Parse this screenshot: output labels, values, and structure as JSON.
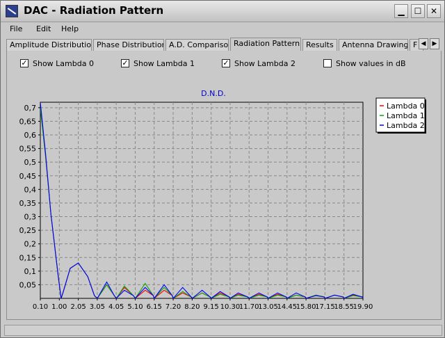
{
  "window": {
    "title": "DAC - Radiation Pattern"
  },
  "menu": [
    "File",
    "Edit",
    "Help"
  ],
  "tabs": [
    "Amplitude Distribution",
    "Phase Distribution",
    "A.D. Comparison",
    "Radiation Pattern",
    "Results",
    "Antenna Drawing",
    "F"
  ],
  "active_tab": "Radiation Pattern",
  "checkboxes": [
    {
      "label": "Show Lambda 0",
      "checked": true
    },
    {
      "label": "Show Lambda 1",
      "checked": true
    },
    {
      "label": "Show Lambda 2",
      "checked": true
    },
    {
      "label": "Show values in dB",
      "checked": false
    }
  ],
  "colors": {
    "lambda0": "#ff0000",
    "lambda1": "#00aa00",
    "lambda2": "#0000ff",
    "chart_title": "#0000cc"
  },
  "chart_data": {
    "type": "line",
    "title": "D.N.D.",
    "xlabel": "",
    "ylabel": "",
    "x_ticks": [
      "0.10",
      "1.00",
      "2.05",
      "3.05",
      "4.05",
      "5.10",
      "6.15",
      "7.20",
      "8.20",
      "9.15",
      "10.30",
      "11.70",
      "13.05",
      "14.45",
      "15.80",
      "17.15",
      "18.55",
      "19.90"
    ],
    "y_ticks": [
      "0,05",
      "0,1",
      "0,15",
      "0,2",
      "0,25",
      "0,3",
      "0,35",
      "0,4",
      "0,45",
      "0,5",
      "0,55",
      "0,6",
      "0,65",
      "0,7"
    ],
    "ylim": [
      0,
      0.72
    ],
    "grid": true,
    "legend_placement": "top-right",
    "series": [
      {
        "name": "Lambda 0",
        "x": [
          0.1,
          0.35,
          0.6,
          0.95,
          1.1,
          1.2,
          1.6,
          2.05,
          2.55,
          2.9,
          3.05,
          3.55,
          3.95,
          4.05,
          4.5,
          5.0,
          5.1,
          5.65,
          6.1,
          6.15,
          6.7,
          7.15,
          7.2,
          7.7,
          8.15,
          8.2,
          8.7,
          9.1,
          9.15,
          9.7,
          10.25,
          10.3,
          10.9,
          11.6,
          11.7,
          12.4,
          13.0,
          13.05,
          13.75,
          14.4,
          14.45,
          15.1,
          15.75,
          15.8,
          16.5,
          17.1,
          17.15,
          17.85,
          18.5,
          18.55,
          19.2,
          19.85,
          19.9
        ],
        "y": [
          0.7,
          0.52,
          0.31,
          0.08,
          0.0,
          0.02,
          0.11,
          0.13,
          0.08,
          0.01,
          0.0,
          0.05,
          0.01,
          0.0,
          0.04,
          0.01,
          0.0,
          0.03,
          0.01,
          0.0,
          0.03,
          0.01,
          0.0,
          0.02,
          0.005,
          0.0,
          0.02,
          0.005,
          0.0,
          0.02,
          0.005,
          0.0,
          0.015,
          0.005,
          0.0,
          0.015,
          0.005,
          0.0,
          0.015,
          0.005,
          0.0,
          0.012,
          0.005,
          0.0,
          0.012,
          0.005,
          0.0,
          0.012,
          0.005,
          0.0,
          0.012,
          0.005,
          0.0
        ]
      },
      {
        "name": "Lambda 1",
        "x": [
          0.1,
          0.35,
          0.6,
          0.95,
          1.1,
          1.2,
          1.6,
          2.05,
          2.55,
          2.9,
          3.05,
          3.55,
          3.95,
          4.05,
          4.5,
          5.0,
          5.1,
          5.65,
          6.1,
          6.15,
          6.7,
          7.15,
          7.2,
          7.7,
          8.15,
          8.2,
          8.7,
          9.1,
          9.15,
          9.7,
          10.25,
          10.3,
          10.9,
          11.6,
          11.7,
          12.4,
          13.0,
          13.05,
          13.75,
          14.4,
          14.45,
          15.1,
          15.75,
          15.8,
          16.5,
          17.1,
          17.15,
          17.85,
          18.5,
          18.55,
          19.2,
          19.85,
          19.9
        ],
        "y": [
          0.7,
          0.52,
          0.31,
          0.08,
          0.0,
          0.02,
          0.11,
          0.13,
          0.08,
          0.01,
          0.0,
          0.05,
          0.01,
          0.0,
          0.045,
          0.01,
          0.0,
          0.055,
          0.01,
          0.0,
          0.04,
          0.01,
          0.0,
          0.025,
          0.005,
          0.0,
          0.02,
          0.005,
          0.0,
          0.015,
          0.005,
          0.0,
          0.012,
          0.005,
          0.0,
          0.012,
          0.005,
          0.0,
          0.012,
          0.005,
          0.0,
          0.012,
          0.005,
          0.0,
          0.012,
          0.005,
          0.0,
          0.012,
          0.005,
          0.0,
          0.01,
          0.005,
          0.0
        ]
      },
      {
        "name": "Lambda 2",
        "x": [
          0.1,
          0.35,
          0.6,
          0.95,
          1.1,
          1.2,
          1.6,
          2.05,
          2.55,
          2.9,
          3.05,
          3.55,
          3.95,
          4.05,
          4.5,
          5.0,
          5.1,
          5.65,
          6.1,
          6.15,
          6.7,
          7.15,
          7.2,
          7.7,
          8.15,
          8.2,
          8.7,
          9.1,
          9.15,
          9.7,
          10.25,
          10.3,
          10.9,
          11.6,
          11.7,
          12.4,
          13.0,
          13.05,
          13.75,
          14.4,
          14.45,
          15.1,
          15.75,
          15.8,
          16.5,
          17.1,
          17.15,
          17.85,
          18.5,
          18.55,
          19.2,
          19.85,
          19.9
        ],
        "y": [
          0.72,
          0.53,
          0.31,
          0.08,
          0.0,
          0.02,
          0.11,
          0.13,
          0.08,
          0.01,
          0.0,
          0.06,
          0.01,
          0.0,
          0.03,
          0.01,
          0.0,
          0.04,
          0.01,
          0.0,
          0.05,
          0.01,
          0.0,
          0.04,
          0.005,
          0.0,
          0.03,
          0.005,
          0.0,
          0.025,
          0.005,
          0.0,
          0.02,
          0.005,
          0.0,
          0.02,
          0.005,
          0.0,
          0.02,
          0.005,
          0.0,
          0.02,
          0.005,
          0.0,
          0.01,
          0.005,
          0.0,
          0.012,
          0.005,
          0.0,
          0.015,
          0.005,
          0.0
        ]
      }
    ]
  }
}
